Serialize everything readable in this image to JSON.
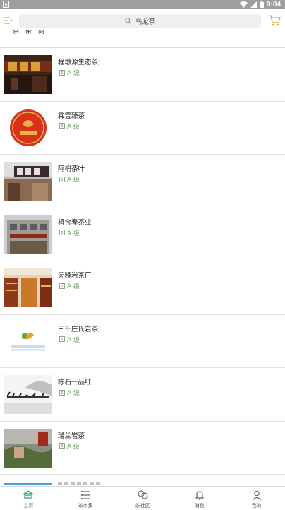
{
  "status_bar": {
    "time": "9:04"
  },
  "search": {
    "query": "乌龙茶"
  },
  "cutoff_text": "茶 茶 商",
  "shops": [
    {
      "name": "程墩源生态茶厂",
      "grade": "A 级",
      "thumb": "shop-front-red"
    },
    {
      "name": "霖雲臻茶",
      "grade": "A 级",
      "thumb": "logo-red-circle"
    },
    {
      "name": "阿梢茶叶",
      "grade": "A 级",
      "thumb": "shop-sign"
    },
    {
      "name": "桐含春茶业",
      "grade": "A 级",
      "thumb": "building"
    },
    {
      "name": "天释岩茶厂",
      "grade": "A 级",
      "thumb": "shop-interior"
    },
    {
      "name": "三千庄氏岩茶厂",
      "grade": "A 级",
      "thumb": "logo-green-leaf"
    },
    {
      "name": "陈石一品红",
      "grade": "A 级",
      "thumb": "calligraphy"
    },
    {
      "name": "瑞兰岩茶",
      "grade": "A 级",
      "thumb": "landscape"
    }
  ],
  "tabs": [
    {
      "label": "主页",
      "icon": "home-icon",
      "active": true
    },
    {
      "label": "茶市集",
      "icon": "list-icon",
      "active": false
    },
    {
      "label": "茶社区",
      "icon": "community-icon",
      "active": false
    },
    {
      "label": "消息",
      "icon": "bell-icon",
      "active": false
    },
    {
      "label": "我的",
      "icon": "user-icon",
      "active": false
    }
  ],
  "colors": {
    "accent": "#3a9a78",
    "grade": "#6a9a6c",
    "cart": "#e8a33a"
  }
}
